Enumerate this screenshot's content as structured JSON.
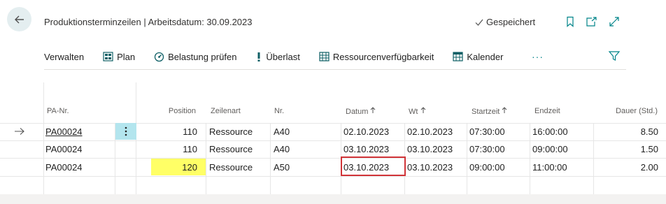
{
  "header": {
    "title": "Produktionsterminzeilen | Arbeitsdatum: 30.09.2023",
    "saved_label": "Gespeichert"
  },
  "actions": {
    "verwalten": "Verwalten",
    "plan": "Plan",
    "belastung": "Belastung prüfen",
    "ueberlast": "Überlast",
    "ressourcen": "Ressourcenverfügbarkeit",
    "kalender": "Kalender",
    "more": "···"
  },
  "columns": {
    "pa_nr": "PA-Nr.",
    "position": "Position",
    "zeilenart": "Zeilenart",
    "nr": "Nr.",
    "datum": "Datum",
    "wt": "Wt",
    "startzeit": "Startzeit",
    "endzeit": "Endzeit",
    "dauer": "Dauer (Std.)"
  },
  "rows": [
    {
      "pa_nr": "PA00024",
      "position": "110",
      "zeilenart": "Ressource",
      "nr": "A40",
      "datum": "02.10.2023",
      "wt": "02.10.2023",
      "startzeit": "07:30:00",
      "endzeit": "16:00:00",
      "dauer": "8.50"
    },
    {
      "pa_nr": "PA00024",
      "position": "110",
      "zeilenart": "Ressource",
      "nr": "A40",
      "datum": "03.10.2023",
      "wt": "03.10.2023",
      "startzeit": "07:30:00",
      "endzeit": "09:00:00",
      "dauer": "1.50"
    },
    {
      "pa_nr": "PA00024",
      "position": "120",
      "zeilenart": "Ressource",
      "nr": "A50",
      "datum": "03.10.2023",
      "wt": "03.10.2023",
      "startzeit": "09:00:00",
      "endzeit": "11:00:00",
      "dauer": "2.00"
    }
  ],
  "colors": {
    "accent": "#008489",
    "highlight_yellow": "#ffff66",
    "selection_red": "#d13438",
    "row_menu_bg": "#b3e5ee"
  },
  "icons": {
    "back": "arrow-left-icon",
    "saved": "checkmark-icon",
    "bookmark": "bookmark-icon",
    "open_new": "open-in-new-window-icon",
    "expand": "expand-icon",
    "plan": "grid-icon",
    "belastung": "gauge-icon",
    "ueberlast": "exclamation-icon",
    "ressourcen": "table-icon",
    "kalender": "calendar-icon",
    "filter": "filter-icon",
    "current_row": "arrow-right-icon",
    "sort_up": "arrow-up-icon",
    "row_menu": "vertical-dots-icon"
  }
}
